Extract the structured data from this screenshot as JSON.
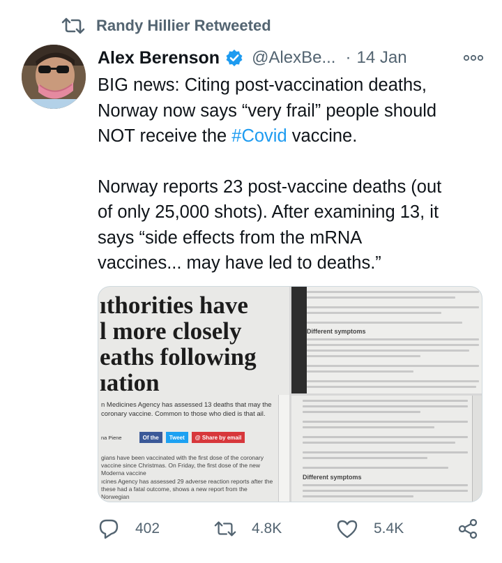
{
  "retweet": {
    "icon": "retweet-icon",
    "text": "Randy Hillier Retweeted"
  },
  "author": {
    "name": "Alex Berenson",
    "handle": "@AlexBe...",
    "separator": "·",
    "time": "14 Jan",
    "verified_icon": "verified-badge-icon"
  },
  "tweet": {
    "para1": [
      "BIG news: Citing post-vaccination deaths,",
      "Norway now says “very frail” people should"
    ],
    "para1_line3_before": "NOT receive the ",
    "hashtag": "#Covid",
    "para1_line3_after": " vaccine.",
    "para2": [
      "Norway reports 23 post-vaccine deaths (out",
      "of only 25,000 shots). After examining 13, it",
      "says “side effects from the mRNA",
      "vaccines... may have led to deaths.”"
    ]
  },
  "media": {
    "left": {
      "headline": [
        "ıthorities have",
        "l more closely",
        "eaths following",
        "ıation"
      ],
      "lede": "n Medicines Agency has assessed 13 deaths that may the coronary vaccine. Common to those who died is that ail.",
      "byline": "na Piene",
      "share_facebook": "Of the",
      "share_twitter": "Tweet",
      "share_email": "@ Share by email",
      "body1": "gians have been vaccinated with the first dose of the coronary vaccine since Christmas. On Friday, the first dose of the new Moderna vaccine",
      "body2": "ıcines Agency has assessed 29 adverse reaction reports after the these had a fatal outcome, shows a new report from the Norwegian"
    },
    "top_right": {
      "heading": "Different symptoms"
    },
    "bottom_right": {
      "heading": "Different symptoms"
    }
  },
  "actions": {
    "reply": {
      "icon": "reply-icon",
      "count": "402"
    },
    "retweet": {
      "icon": "retweet-icon",
      "count": "4.8K"
    },
    "like": {
      "icon": "heart-icon",
      "count": "5.4K"
    },
    "share": {
      "icon": "share-icon"
    }
  },
  "colors": {
    "accent": "#1d9bf0",
    "secondary_text": "#536471",
    "primary_text": "#0f1419"
  }
}
